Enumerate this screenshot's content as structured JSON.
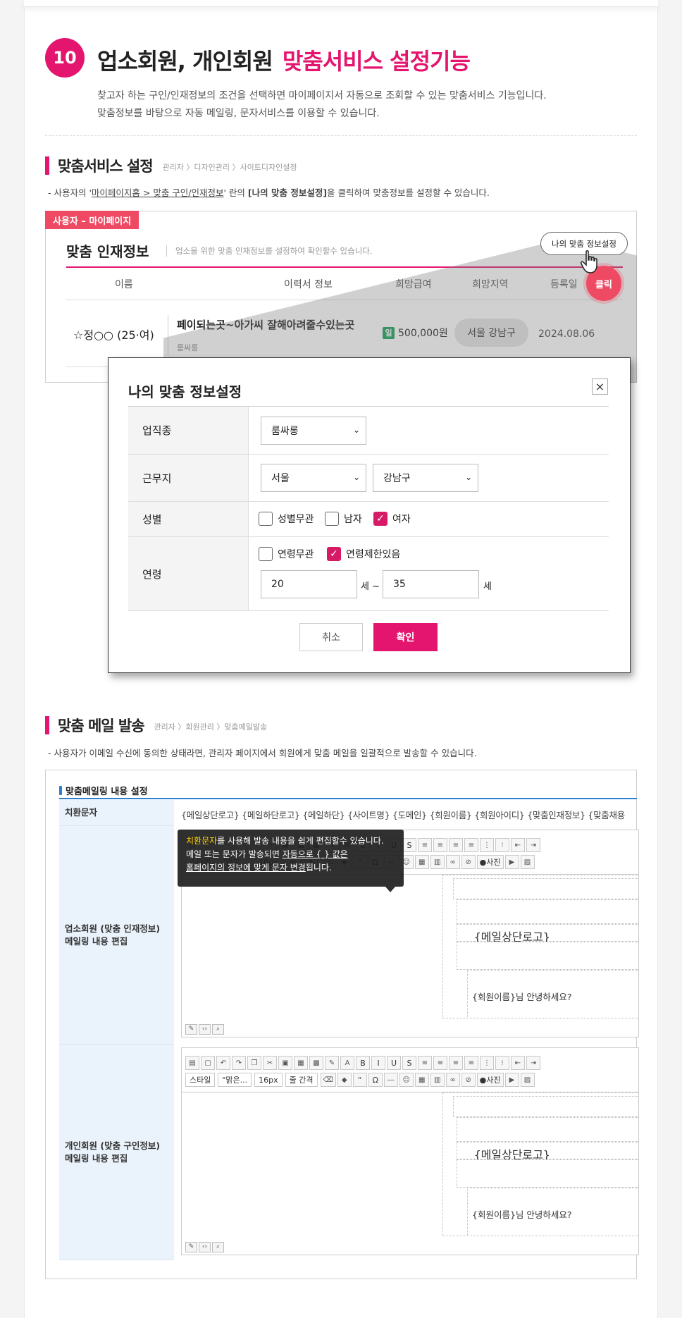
{
  "section": {
    "number": "10",
    "title_black": "업소회원, 개인회원",
    "title_pink": "맞춤서비스 설정기능",
    "desc_line1": "찾고자 하는 구인/인재정보의 조건을 선택하면 마이페이지서 자동으로 조회할 수 있는 맞춤서비스 기능입니다.",
    "desc_line2": "맞춤정보를 바탕으로 자동 메일링, 문자서비스를 이용할 수 있습니다."
  },
  "setting": {
    "title": "맞춤서비스 설정",
    "crumb": "관리자 〉디자인관리 〉사이트디자인설정",
    "desc_pre": "사용자의 '",
    "desc_link": "마이페이지홈 > 맞춤 구인/인재정보",
    "desc_mid": "' 란의 ",
    "desc_bold": "[나의 맞춤 정보설정]",
    "desc_post": "을 클릭하여 맞춤정보를 설정할 수 있습니다."
  },
  "mypage": {
    "tag": "사용자 – 마이페이지",
    "title": "맞춤 인재정보",
    "subtitle": "업소을 위한 맞춤 인재정보를 설정하여 확인할수 있습니다.",
    "settings_button": "나의 맞춤 정보설정",
    "click_label": "클릭",
    "columns": [
      "이름",
      "이력서 정보",
      "희망급여",
      "희망지역",
      "등록일"
    ],
    "row": {
      "star": "☆",
      "name": "정○○ (25·여)",
      "resume_title": "페이되는곳~아가씨 잘해아려줄수있는곳",
      "category": "룸싸롱",
      "pay_icon": "일",
      "pay": "500,000원",
      "area": "서울 강남구",
      "date": "2024.08.06"
    }
  },
  "modal": {
    "title": "나의 맞춤 정보설정",
    "close": "×",
    "rows": {
      "job": {
        "label": "업직종",
        "value": "룸싸롱"
      },
      "location": {
        "label": "근무지",
        "city": "서울",
        "district": "강남구"
      },
      "gender": {
        "label": "성별",
        "opt1": "성별무관",
        "opt2": "남자",
        "opt3": "여자"
      },
      "age": {
        "label": "연령",
        "opt1": "연령무관",
        "opt2": "연령제한있음",
        "min": "20",
        "sep": "세 ~",
        "max": "35",
        "unit": "세"
      }
    },
    "check_mark": "✓",
    "chevron": "⌄",
    "cancel": "취소",
    "confirm": "확인"
  },
  "mail": {
    "title": "맞춤 메일 발송",
    "crumb": "관리자 〉회원관리 〉맞춤메일발송",
    "desc": "사용자가 이메일 수신에 동의한 상태라면, 관리자 페이지에서 회원에게 맞춤 메일을 일괄적으로 발송할 수 있습니다.",
    "box_title": "맞춤메일링 내용 설정",
    "subs_label": "치환문자",
    "subs_value": "{메일상단로고} {메일하단로고} {메일하단} {사이트명} {도메인} {회원이름} {회원아이디} {맞춤인재정보} {맞춤채용",
    "editor1_label_1": "업소회원 (맞춤 인재정보)",
    "editor1_label_2": "메일링 내용 편집",
    "editor2_label_1": "개인회원 (맞춤 구인정보)",
    "editor2_label_2": "메일링 내용 편집",
    "tpl_logo": "{메일상단로고}",
    "tpl_greeting": "{회원이름}님 안녕하세요?",
    "toolbar": {
      "style": "스타일",
      "font": "\"맑은...",
      "size": "16px",
      "line": "줄 간격",
      "photo": "사진",
      "bold": "B",
      "italic": "I",
      "underline": "U",
      "strike": "S",
      "quote": "“",
      "omega": "Ω"
    },
    "tooltip": {
      "w1": "치환문자",
      "t1": "를 사용해 발송 내용을 쉽게 편집할수 있습니다.",
      "t2a": "메일 또는 문자가 발송되면 ",
      "t2b": "자동으로 { } 값은",
      "t3a": "홈페이지의 정보에 맞게 문자 변경",
      "t3b": "됩니다."
    }
  }
}
